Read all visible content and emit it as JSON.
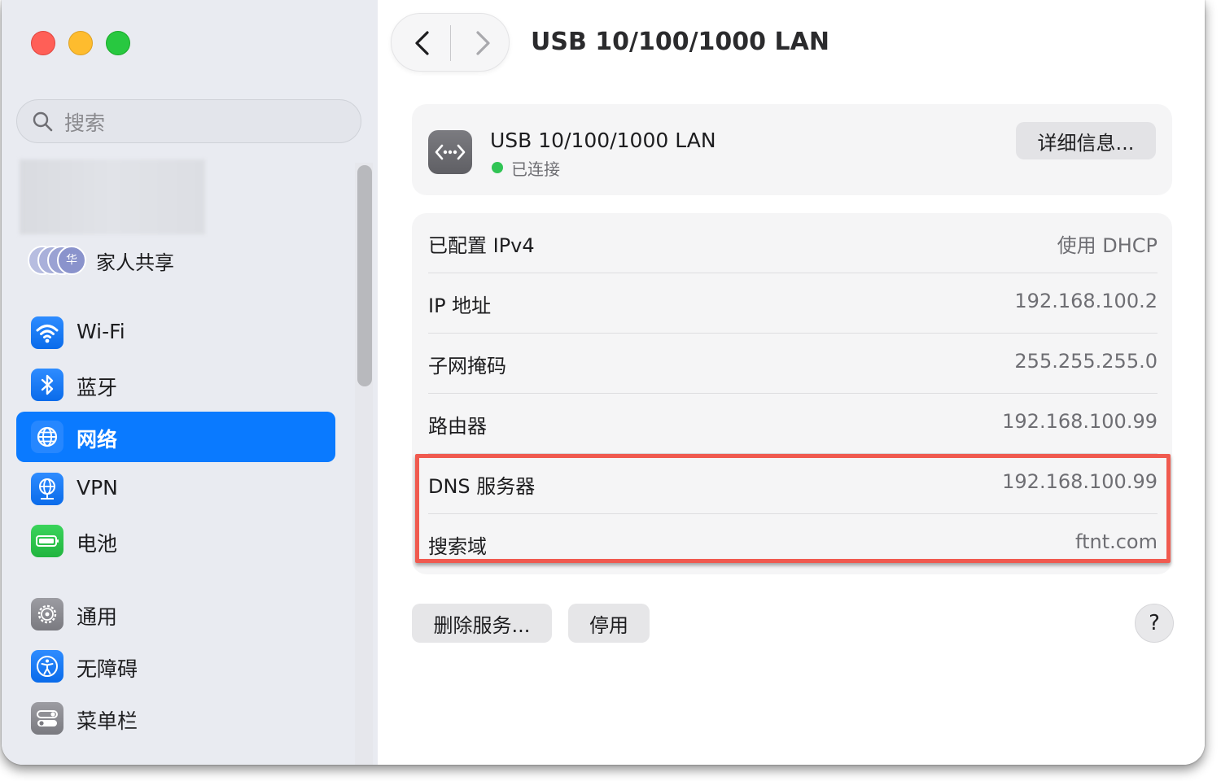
{
  "window": {
    "title": "USB 10/100/1000 LAN"
  },
  "sidebar": {
    "search_placeholder": "搜索",
    "family_label": "家人共享",
    "family_avatar_initial": "华",
    "items": [
      {
        "label": "Wi-Fi",
        "icon": "wifi-icon"
      },
      {
        "label": "蓝牙",
        "icon": "bluetooth-icon"
      },
      {
        "label": "网络",
        "icon": "globe-icon",
        "active": true
      },
      {
        "label": "VPN",
        "icon": "vpn-globe-icon"
      },
      {
        "label": "电池",
        "icon": "battery-icon"
      },
      {
        "label": "通用",
        "icon": "gear-icon"
      },
      {
        "label": "无障碍",
        "icon": "accessibility-icon"
      },
      {
        "label": "菜单栏",
        "icon": "toggles-icon"
      }
    ]
  },
  "service": {
    "name": "USB 10/100/1000 LAN",
    "status": "已连接",
    "details_button": "详细信息...",
    "status_color": "#30c454"
  },
  "info": {
    "rows": [
      {
        "key": "已配置 IPv4",
        "value": "使用 DHCP"
      },
      {
        "key": "IP 地址",
        "value": "192.168.100.2"
      },
      {
        "key": "子网掩码",
        "value": "255.255.255.0"
      },
      {
        "key": "路由器",
        "value": "192.168.100.99"
      },
      {
        "key": "DNS 服务器",
        "value": "192.168.100.99"
      },
      {
        "key": "搜索域",
        "value": "ftnt.com"
      }
    ]
  },
  "actions": {
    "remove_service": "删除服务...",
    "disable": "停用",
    "help": "?"
  },
  "colors": {
    "accent": "#0a7aff",
    "highlight_border": "#f05a4f"
  }
}
